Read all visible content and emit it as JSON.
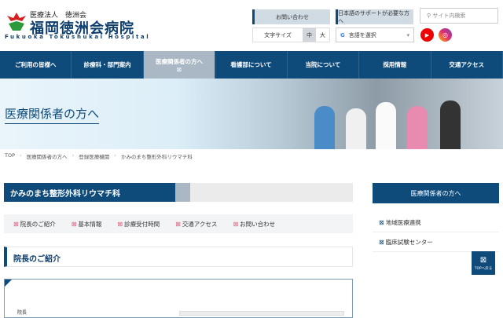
{
  "header": {
    "org": "医療法人　徳洲会",
    "name": "福岡徳洲会病院",
    "name_en": "Fukuoka Tokushukai Hospital",
    "contact": "お問い合わせ",
    "jp_support": "日本語のサポートが必要な方へ",
    "search_placeholder": "サイト内検索",
    "font_size_label": "文字サイズ",
    "font_mid": "中",
    "font_large": "大",
    "translate": "言語を選択",
    "youtube": "▶",
    "instagram": "◎"
  },
  "nav": [
    {
      "label": "ご利用の皆様へ"
    },
    {
      "label": "診療科・部門案内"
    },
    {
      "label": "医療関係者の方へ"
    },
    {
      "label": "看護部について"
    },
    {
      "label": "当院について"
    },
    {
      "label": "採用情報"
    },
    {
      "label": "交通アクセス"
    }
  ],
  "hero": {
    "title": "医療関係者の方へ"
  },
  "breadcrumb": [
    "TOP",
    "医療関係者の方へ",
    "登録医療機関",
    "かみのまち整形外科リウマチ科"
  ],
  "page": {
    "title": "かみのまち整形外科リウマチ科",
    "anchors": [
      "院長のご紹介",
      "基本情報",
      "診療受付時間",
      "交通アクセス",
      "お問い合わせ"
    ],
    "section_title": "院長のご紹介",
    "director_label": "院長"
  },
  "sidebar": {
    "header": "医療関係者の方へ",
    "items": [
      "地域医療連携",
      "臨床試験センター"
    ]
  },
  "top_button": "TOPへ戻る",
  "colors": {
    "brand": "#0e4a7a",
    "active": "#a9b8c4"
  }
}
